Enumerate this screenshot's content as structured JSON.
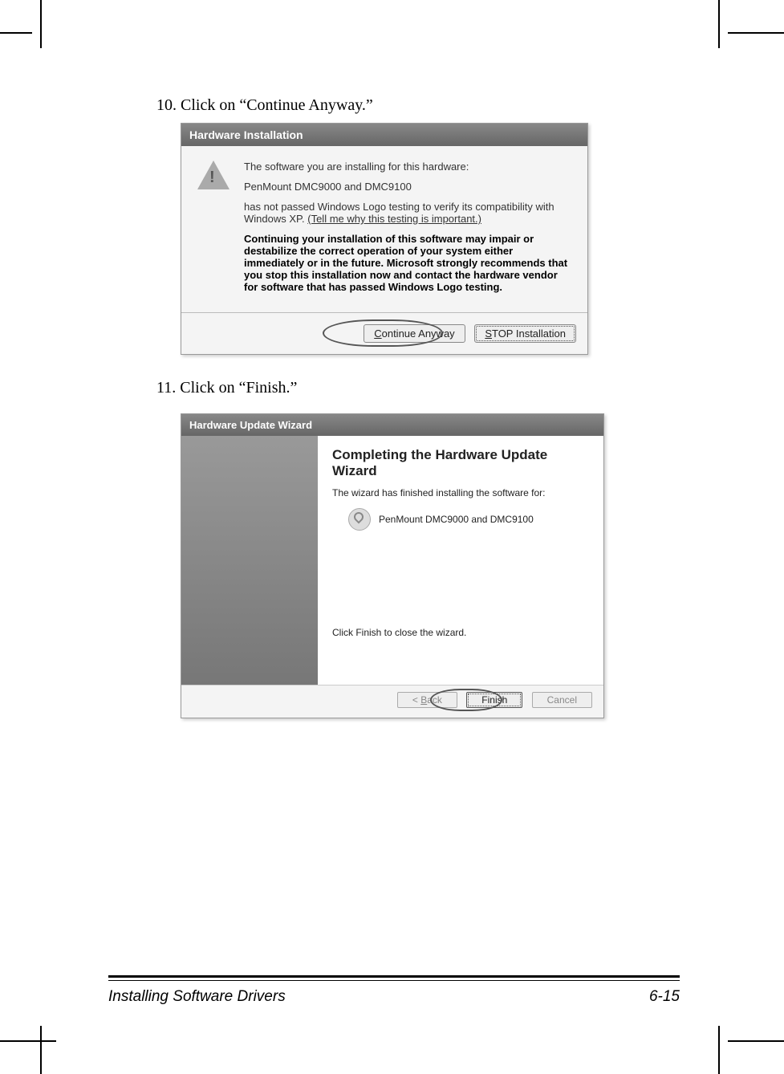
{
  "step10": "10. Click on “Continue Anyway.”",
  "step11": "11. Click on “Finish.”",
  "dialog1": {
    "title": "Hardware Installation",
    "line1": "The software you are installing for this hardware:",
    "device": "PenMount DMC9000 and DMC9100",
    "line2a": "has not passed Windows Logo testing to verify its compatibility with Windows XP. ",
    "link": "(Tell me why this testing is important.)",
    "warn": "Continuing your installation of this software may impair or destabilize the correct operation of your system either immediately or in the future. Microsoft strongly recommends that you stop this installation now and contact the hardware vendor for software that has passed Windows Logo testing.",
    "btnContinuePrefix": "C",
    "btnContinueRest": "ontinue Anyway",
    "btnStopPrefix": "S",
    "btnStopRest": "TOP Installation"
  },
  "dialog2": {
    "title": "Hardware Update Wizard",
    "heading": "Completing the Hardware Update Wizard",
    "sub": "The wizard has finished installing the software for:",
    "device": "PenMount DMC9000 and DMC9100",
    "closeLine": "Click Finish to close the wizard.",
    "btnBackPrefix": "< ",
    "btnBackU": "B",
    "btnBackRest": "ack",
    "btnFinish": "Finish",
    "btnCancel": "Cancel"
  },
  "footer": {
    "left": "Installing Software Drivers",
    "right": "6-15"
  }
}
